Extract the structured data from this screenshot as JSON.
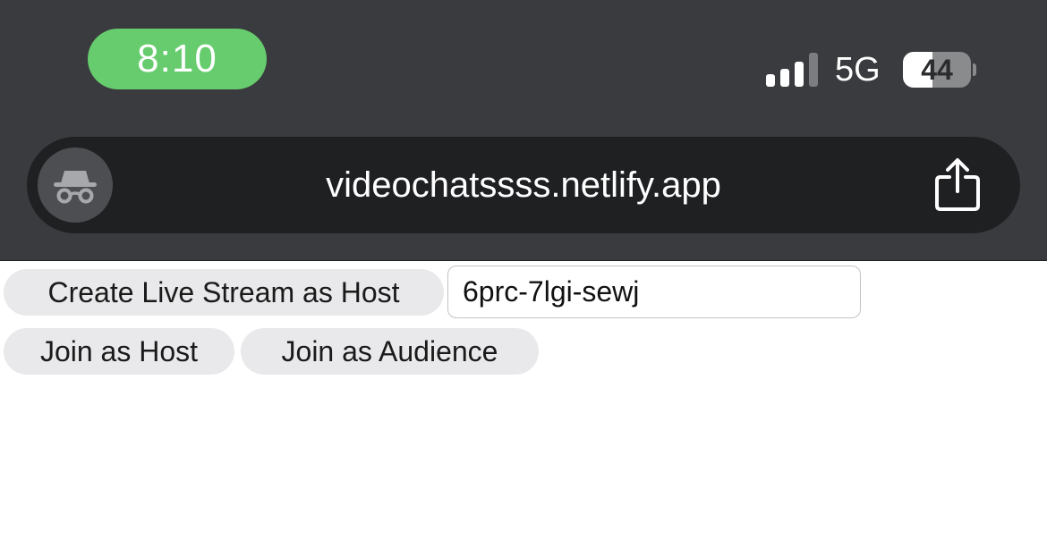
{
  "status_bar": {
    "time": "8:10",
    "network": "5G",
    "battery_level": "44",
    "signal_bars": 3,
    "signal_bars_total": 4,
    "time_pill_color": "#66cc6e"
  },
  "address_bar": {
    "url": "videochatssss.netlify.app",
    "left_icon": "incognito-icon",
    "right_icon": "share-icon"
  },
  "page": {
    "create_button_label": "Create Live Stream as Host",
    "stream_id_value": "6prc-7lgi-sewj",
    "join_host_label": "Join as Host",
    "join_audience_label": "Join as Audience"
  }
}
